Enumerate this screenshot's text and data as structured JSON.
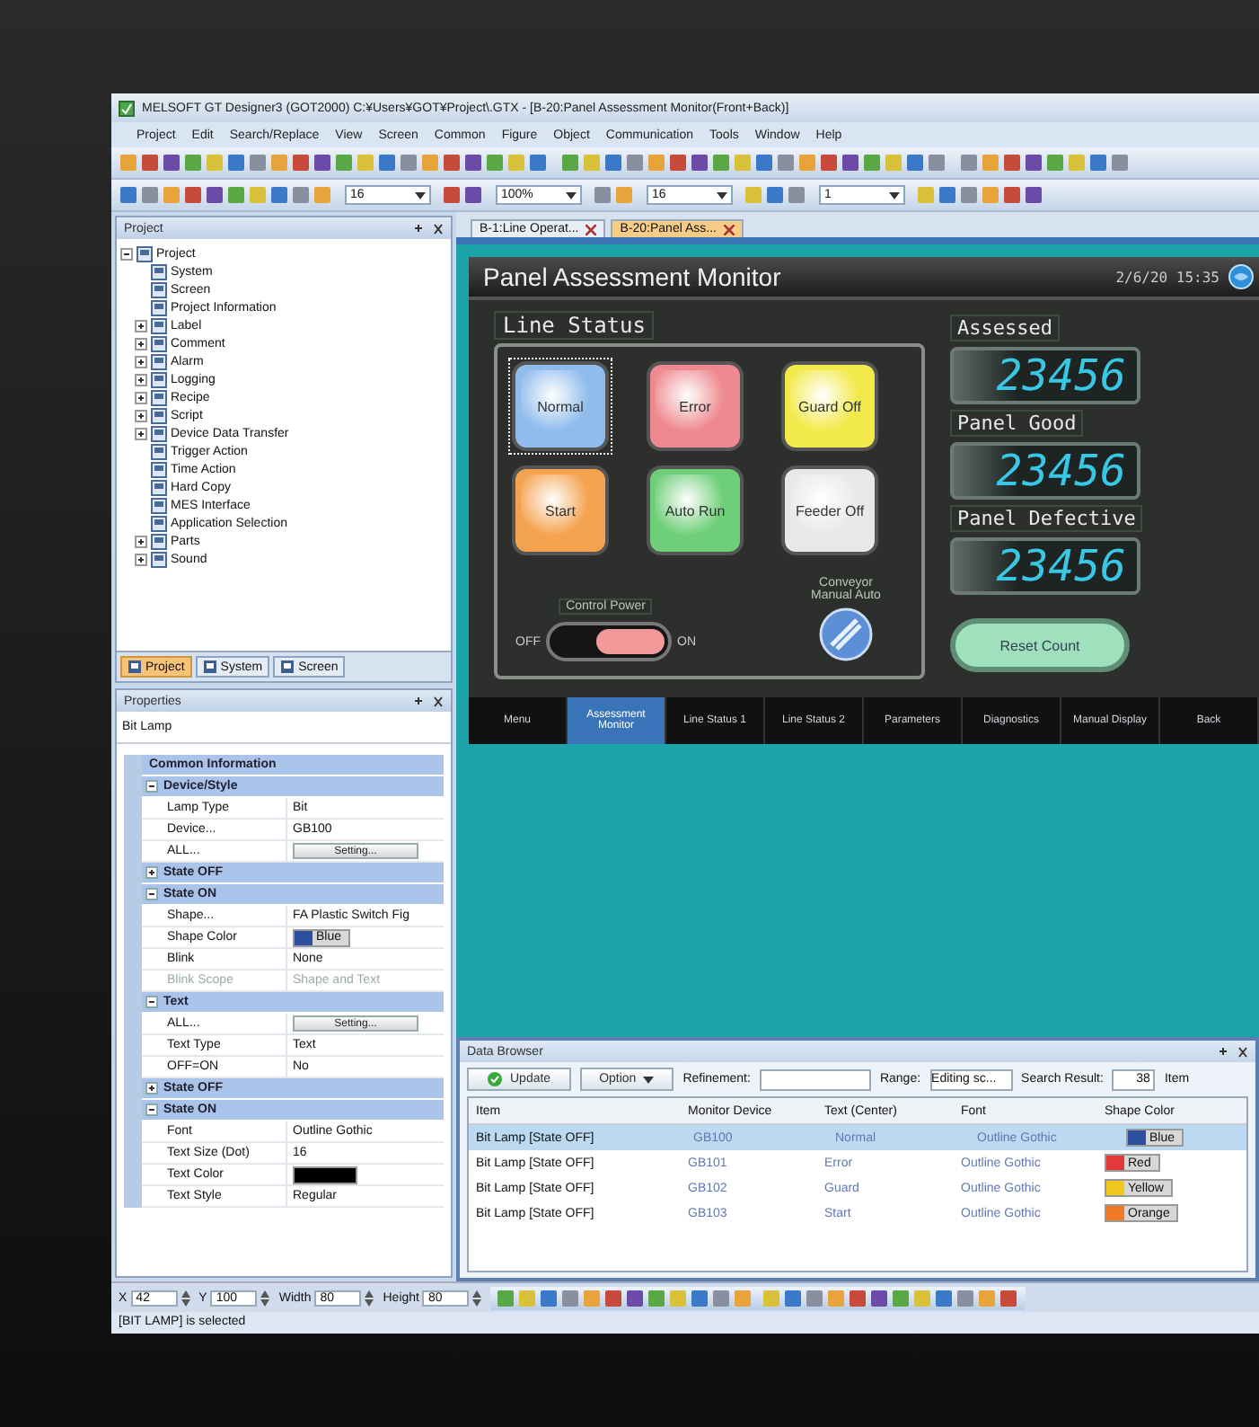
{
  "window": {
    "title": "MELSOFT GT Designer3 (GOT2000) C:¥Users¥GOT¥Project\\.GTX - [B-20:Panel Assessment Monitor(Front+Back)]"
  },
  "menu": [
    "Project",
    "Edit",
    "Search/Replace",
    "View",
    "Screen",
    "Common",
    "Figure",
    "Object",
    "Communication",
    "Tools",
    "Window",
    "Help"
  ],
  "toolbar": {
    "fields": [
      "16",
      "100%",
      "16",
      "1"
    ]
  },
  "project_panel": {
    "title": "Project",
    "tree": [
      {
        "label": "Project",
        "kind": "branch",
        "expanded": true,
        "children": [
          {
            "label": "System",
            "kind": "leaf"
          },
          {
            "label": "Screen",
            "kind": "leaf"
          },
          {
            "label": "Project Information",
            "kind": "leaf"
          },
          {
            "label": "Label",
            "kind": "branch",
            "expanded": false
          },
          {
            "label": "Comment",
            "kind": "branch",
            "expanded": false
          },
          {
            "label": "Alarm",
            "kind": "branch",
            "expanded": false
          },
          {
            "label": "Logging",
            "kind": "branch",
            "expanded": false
          },
          {
            "label": "Recipe",
            "kind": "branch",
            "expanded": false
          },
          {
            "label": "Script",
            "kind": "branch",
            "expanded": false
          },
          {
            "label": "Device Data Transfer",
            "kind": "branch",
            "expanded": false
          },
          {
            "label": "Trigger Action",
            "kind": "leaf"
          },
          {
            "label": "Time Action",
            "kind": "leaf"
          },
          {
            "label": "Hard Copy",
            "kind": "leaf"
          },
          {
            "label": "MES Interface",
            "kind": "leaf"
          },
          {
            "label": "Application Selection",
            "kind": "leaf"
          },
          {
            "label": "Parts",
            "kind": "branch",
            "expanded": false
          },
          {
            "label": "Sound",
            "kind": "branch",
            "expanded": false
          }
        ]
      }
    ],
    "tabs": [
      {
        "label": "Project",
        "selected": true
      },
      {
        "label": "System",
        "selected": false
      },
      {
        "label": "Screen",
        "selected": false
      }
    ]
  },
  "properties_panel": {
    "title": "Properties",
    "object": "Bit Lamp",
    "rows": [
      {
        "kind": "category",
        "label": "Common Information"
      },
      {
        "kind": "section",
        "label": "Device/Style",
        "expanded": true
      },
      {
        "kind": "text",
        "label": "Lamp Type",
        "value": "Bit",
        "disabled": false
      },
      {
        "kind": "text",
        "label": "Device...",
        "value": "GB100",
        "disabled": false
      },
      {
        "kind": "button",
        "label": "ALL...",
        "value": "Setting...",
        "disabled": false
      },
      {
        "kind": "section",
        "label": "State OFF",
        "expanded": false
      },
      {
        "kind": "section",
        "label": "State ON",
        "expanded": true
      },
      {
        "kind": "text",
        "label": "Shape...",
        "value": "FA Plastic Switch Fig",
        "disabled": false
      },
      {
        "kind": "swatch",
        "label": "Shape Color",
        "value": "Blue",
        "color": "#2d4f9e",
        "disabled": false
      },
      {
        "kind": "text",
        "label": "Blink",
        "value": "None",
        "disabled": false
      },
      {
        "kind": "text",
        "label": "Blink Scope",
        "value": "Shape and Text",
        "disabled": true
      },
      {
        "kind": "section",
        "label": "Text",
        "expanded": true
      },
      {
        "kind": "button",
        "label": "ALL...",
        "value": "Setting...",
        "disabled": false
      },
      {
        "kind": "text",
        "label": "Text Type",
        "value": "Text",
        "disabled": false
      },
      {
        "kind": "text",
        "label": "OFF=ON",
        "value": "No",
        "disabled": false
      },
      {
        "kind": "section",
        "label": "State OFF",
        "expanded": false
      },
      {
        "kind": "section",
        "label": "State ON",
        "expanded": true
      },
      {
        "kind": "text",
        "label": "Font",
        "value": "Outline Gothic",
        "disabled": false
      },
      {
        "kind": "text",
        "label": "Text Size (Dot)",
        "value": "16",
        "disabled": false
      },
      {
        "kind": "swatch",
        "label": "Text Color",
        "color": "#000000",
        "disabled": false
      },
      {
        "kind": "text",
        "label": "Text Style",
        "value": "Regular",
        "disabled": false
      }
    ]
  },
  "coordinates": [
    {
      "label": "X",
      "value": "42"
    },
    {
      "label": "Y",
      "value": "100"
    },
    {
      "label": "Width",
      "value": "80"
    },
    {
      "label": "Height",
      "value": "80"
    }
  ],
  "document_tabs": [
    {
      "label": "B-1:Line Operat...",
      "selected": false
    },
    {
      "label": "B-20:Panel Ass...",
      "selected": true
    }
  ],
  "hmi": {
    "title": "Panel Assessment Monitor",
    "clock": "2/6/20 15:35",
    "group_title": "Line Status",
    "lamps": [
      {
        "label": "Normal",
        "color": "#8fbcec",
        "selected": true
      },
      {
        "label": "Error",
        "color": "#ee8a8f",
        "selected": false
      },
      {
        "label": "Guard Off",
        "color": "#f2ea4a",
        "selected": false
      },
      {
        "label": "Start",
        "color": "#f4a24e",
        "selected": false
      },
      {
        "label": "Auto Run",
        "color": "#6fcf78",
        "selected": false
      },
      {
        "label": "Feeder Off",
        "color": "#e6e8ea",
        "selected": false
      }
    ],
    "power": {
      "label": "Control Power",
      "off_label": "OFF",
      "on_label": "ON",
      "on": true
    },
    "selector": {
      "label": "Conveyor Manual Auto",
      "auto": true
    },
    "counters": [
      {
        "label": "Assessed",
        "value": "23456"
      },
      {
        "label": "Panel Good",
        "value": "23456"
      },
      {
        "label": "Panel Defective",
        "value": "23456"
      }
    ],
    "reset_button": "Reset Count",
    "nav": [
      {
        "label": "Menu",
        "selected": false
      },
      {
        "label": "Assessment Monitor",
        "selected": true
      },
      {
        "label": "Line Status 1",
        "selected": false
      },
      {
        "label": "Line Status 2",
        "selected": false
      },
      {
        "label": "Parameters",
        "selected": false
      },
      {
        "label": "Diagnostics",
        "selected": false
      },
      {
        "label": "Manual Display",
        "selected": false
      },
      {
        "label": "Back",
        "selected": false
      }
    ]
  },
  "data_browser": {
    "title": "Data Browser",
    "update_button": "Update",
    "option_button": "Option",
    "refinement_label": "Refinement:",
    "range_label": "Range:",
    "range_value": "Editing sc...",
    "result_label": "Search Result:",
    "result_value": "38",
    "result_unit": "Item",
    "columns": [
      "Item",
      "Monitor Device",
      "Text (Center)",
      "Font",
      "Shape Color"
    ],
    "rows": [
      {
        "item": "Bit Lamp [State OFF]",
        "device": "GB100",
        "text": "Normal",
        "font": "Outline Gothic",
        "shape_color": "Blue",
        "color": "#2d4f9e",
        "selected": true
      },
      {
        "item": "Bit Lamp [State OFF]",
        "device": "GB101",
        "text": "Error",
        "font": "Outline Gothic",
        "shape_color": "Red",
        "color": "#e03a3a",
        "selected": false
      },
      {
        "item": "Bit Lamp [State OFF]",
        "device": "GB102",
        "text": "Guard",
        "font": "Outline Gothic",
        "shape_color": "Yellow",
        "color": "#f2c81e",
        "selected": false
      },
      {
        "item": "Bit Lamp [State OFF]",
        "device": "GB103",
        "text": "Start",
        "font": "Outline Gothic",
        "shape_color": "Orange",
        "color": "#ee7a22",
        "selected": false
      }
    ]
  },
  "status_bar": "[BIT LAMP] is selected"
}
